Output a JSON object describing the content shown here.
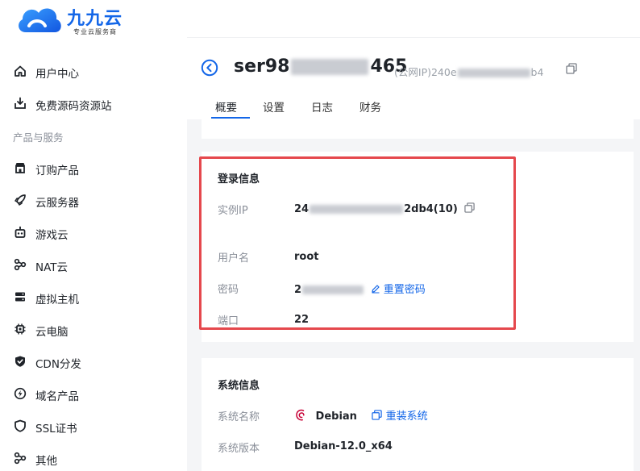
{
  "brand": {
    "name": "九九云",
    "tagline": "专业云服务商",
    "color": "#1366e8"
  },
  "sidebar": {
    "top_items": [
      {
        "label": "用户中心",
        "icon": "home-icon"
      },
      {
        "label": "免费源码资源站",
        "icon": "download-box-icon"
      }
    ],
    "section_label": "产品与服务",
    "items": [
      {
        "label": "订购产品",
        "icon": "store-icon"
      },
      {
        "label": "云服务器",
        "icon": "rocket-icon"
      },
      {
        "label": "游戏云",
        "icon": "robot-icon"
      },
      {
        "label": "NAT云",
        "icon": "nodes-icon"
      },
      {
        "label": "虚拟主机",
        "icon": "server-icon"
      },
      {
        "label": "云电脑",
        "icon": "chip-icon"
      },
      {
        "label": "CDN分发",
        "icon": "shield-check-icon"
      },
      {
        "label": "域名产品",
        "icon": "bolt-circle-icon"
      },
      {
        "label": "SSL证书",
        "icon": "shield-icon"
      },
      {
        "label": "其他",
        "icon": "nodes-icon"
      }
    ]
  },
  "header": {
    "server_name_prefix": "ser98",
    "server_name_suffix": "465",
    "public_ip_label": "(公网IP)240e",
    "public_ip_suffix": "b4"
  },
  "tabs": [
    {
      "label": "概要",
      "active": true
    },
    {
      "label": "设置",
      "active": false
    },
    {
      "label": "日志",
      "active": false
    },
    {
      "label": "财务",
      "active": false
    }
  ],
  "login_info": {
    "title": "登录信息",
    "instance_ip_label": "实例IP",
    "instance_ip_prefix": "24",
    "instance_ip_suffix": "2db4(10)",
    "username_label": "用户名",
    "username_value": "root",
    "password_label": "密码",
    "password_prefix": "2",
    "reset_password_label": "重置密码",
    "port_label": "端口",
    "port_value": "22"
  },
  "system_info": {
    "title": "系统信息",
    "os_name_label": "系统名称",
    "os_name_value": "Debian",
    "reinstall_label": "重装系统",
    "os_version_label": "系统版本",
    "os_version_value": "Debian-12.0_x64"
  },
  "colors": {
    "highlight": "#e5484d",
    "link": "#1366e8",
    "muted": "#8a8f99",
    "background": "#f4f5f7"
  }
}
